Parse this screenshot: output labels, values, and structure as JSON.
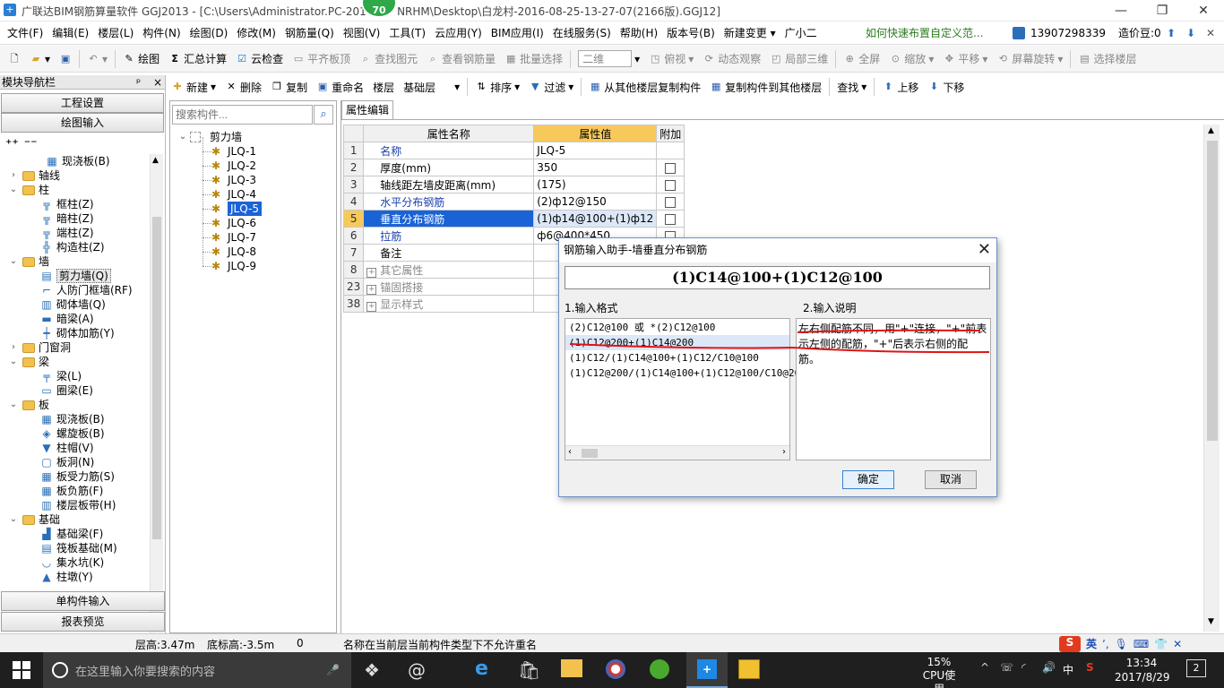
{
  "window": {
    "title": "广联达BIM钢筋算量软件 GGJ2013 - [C:\\Users\\Administrator.PC-201         NRHM\\Desktop\\白龙村-2016-08-25-13-27-07(2166版).GGJ12]",
    "badge": "70",
    "logo": "+"
  },
  "menu": [
    "文件(F)",
    "编辑(E)",
    "楼层(L)",
    "构件(N)",
    "绘图(D)",
    "修改(M)",
    "钢筋量(Q)",
    "视图(V)",
    "工具(T)",
    "云应用(Y)",
    "BIM应用(I)",
    "在线服务(S)",
    "帮助(H)",
    "版本号(B)",
    "新建变更 ▾",
    "广小二"
  ],
  "menu_right": {
    "hint": "如何快速布置自定义范...",
    "phone": "13907298339",
    "beans": "造价豆:0"
  },
  "toolbar1": {
    "draw": "绘图",
    "sum": "汇总计算",
    "cloud": "云检查",
    "flat": "平齐板顶",
    "find": "查找图元",
    "view_rebar": "查看钢筋量",
    "batch": "批量选择",
    "view2d": "二维",
    "top_view": "俯视",
    "dynamic": "动态观察",
    "local3d": "局部三维",
    "fullscreen": "全屏",
    "zoom": "缩放",
    "pan": "平移",
    "rotate": "屏幕旋转",
    "select_floor": "选择楼层"
  },
  "toolbar2": {
    "new": "新建",
    "delete": "删除",
    "copy": "复制",
    "rename": "重命名",
    "floor_label": "楼层",
    "floor_value": "基础层",
    "sort": "排序",
    "filter": "过滤",
    "copy_from": "从其他楼层复制构件",
    "copy_to": "复制构件到其他楼层",
    "find": "查找",
    "up": "上移",
    "down": "下移"
  },
  "nav": {
    "title": "模块导航栏",
    "pin": "ᵖ",
    "close": "×",
    "project_settings": "工程设置",
    "draw_input": "绘图输入",
    "single_input": "单构件输入",
    "report": "报表预览"
  },
  "tree": [
    {
      "level": 2,
      "label": "现浇板(B)",
      "icon": "▦"
    },
    {
      "level": 0,
      "label": "轴线",
      "folder": true,
      "exp": "›"
    },
    {
      "level": 0,
      "label": "柱",
      "folder": true,
      "exp": "⌄"
    },
    {
      "level": 1,
      "label": "框柱(Z)",
      "icon": "╦"
    },
    {
      "level": 1,
      "label": "暗柱(Z)",
      "icon": "╦"
    },
    {
      "level": 1,
      "label": "端柱(Z)",
      "icon": "╦"
    },
    {
      "level": 1,
      "label": "构造柱(Z)",
      "icon": "╬"
    },
    {
      "level": 0,
      "label": "墙",
      "folder": true,
      "exp": "⌄"
    },
    {
      "level": 1,
      "label": "剪力墙(Q)",
      "icon": "▤",
      "selected": true
    },
    {
      "level": 1,
      "label": "人防门框墙(RF)",
      "icon": "⌐"
    },
    {
      "level": 1,
      "label": "砌体墙(Q)",
      "icon": "▥"
    },
    {
      "level": 1,
      "label": "暗梁(A)",
      "icon": "▬"
    },
    {
      "level": 1,
      "label": "砌体加筋(Y)",
      "icon": "┿"
    },
    {
      "level": 0,
      "label": "门窗洞",
      "folder": true,
      "exp": "›"
    },
    {
      "level": 0,
      "label": "梁",
      "folder": true,
      "exp": "⌄"
    },
    {
      "level": 1,
      "label": "梁(L)",
      "icon": "╤"
    },
    {
      "level": 1,
      "label": "圈梁(E)",
      "icon": "▭"
    },
    {
      "level": 0,
      "label": "板",
      "folder": true,
      "exp": "⌄"
    },
    {
      "level": 1,
      "label": "现浇板(B)",
      "icon": "▦"
    },
    {
      "level": 1,
      "label": "螺旋板(B)",
      "icon": "◈"
    },
    {
      "level": 1,
      "label": "柱帽(V)",
      "icon": "▼"
    },
    {
      "level": 1,
      "label": "板洞(N)",
      "icon": "▢"
    },
    {
      "level": 1,
      "label": "板受力筋(S)",
      "icon": "▦"
    },
    {
      "level": 1,
      "label": "板负筋(F)",
      "icon": "▦"
    },
    {
      "level": 1,
      "label": "楼层板带(H)",
      "icon": "▥"
    },
    {
      "level": 0,
      "label": "基础",
      "folder": true,
      "exp": "⌄"
    },
    {
      "level": 1,
      "label": "基础梁(F)",
      "icon": "▟"
    },
    {
      "level": 1,
      "label": "筏板基础(M)",
      "icon": "▤"
    },
    {
      "level": 1,
      "label": "集水坑(K)",
      "icon": "◡"
    },
    {
      "level": 1,
      "label": "柱墩(Y)",
      "icon": "▲"
    }
  ],
  "components": {
    "search_placeholder": "搜索构件...",
    "root": "剪力墙",
    "items": [
      "JLQ-1",
      "JLQ-2",
      "JLQ-3",
      "JLQ-4",
      "JLQ-5",
      "JLQ-6",
      "JLQ-7",
      "JLQ-8",
      "JLQ-9"
    ],
    "selected": "JLQ-5"
  },
  "props": {
    "tab": "属性编辑",
    "headers": [
      "属性名称",
      "属性值",
      "附加"
    ],
    "rows": [
      {
        "n": "1",
        "name": "名称",
        "value": "JLQ-5",
        "blue": true,
        "check": false,
        "hasCheck": false
      },
      {
        "n": "2",
        "name": "厚度(mm)",
        "value": "350",
        "blue": false,
        "check": false,
        "hasCheck": true
      },
      {
        "n": "3",
        "name": "轴线距左墙皮距离(mm)",
        "value": "(175)",
        "blue": false,
        "check": false,
        "hasCheck": true
      },
      {
        "n": "4",
        "name": "水平分布钢筋",
        "value": "(2)ф12@150",
        "blue": true,
        "check": false,
        "hasCheck": true
      },
      {
        "n": "5",
        "name": "垂直分布钢筋",
        "value": "(1)ф14@100+(1)ф12",
        "blue": true,
        "check": false,
        "hasCheck": true,
        "selected": true
      },
      {
        "n": "6",
        "name": "拉筋",
        "value": "ф6@400*450",
        "blue": true,
        "check": false,
        "hasCheck": true
      },
      {
        "n": "7",
        "name": "备注",
        "value": "",
        "blue": false,
        "check": false,
        "hasCheck": true
      },
      {
        "n": "8",
        "name": "其它属性",
        "value": "",
        "grey": true,
        "plus": true
      },
      {
        "n": "23",
        "name": "锚固搭接",
        "value": "",
        "grey": true,
        "plus": true
      },
      {
        "n": "38",
        "name": "显示样式",
        "value": "",
        "grey": true,
        "plus": true
      }
    ]
  },
  "dialog": {
    "title": "钢筋输入助手-墙垂直分布钢筋",
    "formula": "(1)C14@100+(1)C12@100",
    "format_label": "1.输入格式",
    "desc_label": "2.输入说明",
    "formats": [
      "(2)C12@100 或 *(2)C12@100",
      "(1)C12@200+(1)C14@200",
      "(1)C12/(1)C14@100+(1)C12/C10@100",
      "(1)C12@200/(1)C14@100+(1)C12@100/C10@200"
    ],
    "description": "左右侧配筋不同，用\"+\"连接，\"+\"前表示左侧的配筋，\"+\"后表示右侧的配筋。",
    "ok": "确定",
    "cancel": "取消"
  },
  "status": {
    "floor_height": "层高:3.47m",
    "bottom_height": "底标高:-3.5m",
    "zero": "0",
    "message": "名称在当前层当前构件类型下不允许重名"
  },
  "taskbar": {
    "search_placeholder": "在这里输入你要搜索的内容",
    "cpu_pct": "15%",
    "cpu_label": "CPU使用",
    "lang": "中",
    "ime": "英",
    "time": "13:34",
    "date": "2017/8/29",
    "notif": "2"
  }
}
